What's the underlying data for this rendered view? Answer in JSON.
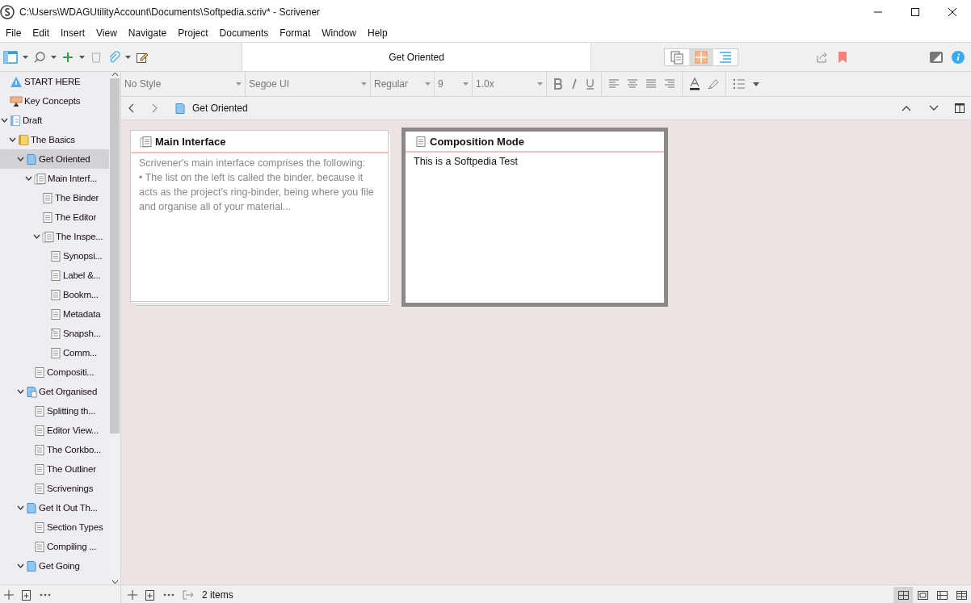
{
  "window": {
    "title": "C:\\Users\\WDAGUtilityAccount\\Documents\\Softpedia.scriv* - Scrivener"
  },
  "menu": [
    "File",
    "Edit",
    "Insert",
    "View",
    "Navigate",
    "Project",
    "Documents",
    "Format",
    "Window",
    "Help"
  ],
  "toolbar": {
    "document_title": "Get Oriented",
    "view_modes": [
      {
        "kind": "scrivenings",
        "selected": false
      },
      {
        "kind": "corkboard",
        "selected": true
      },
      {
        "kind": "outliner",
        "selected": false
      }
    ]
  },
  "format_bar": {
    "style": "No Style",
    "font": "Segoe UI",
    "weight": "Regular",
    "size": "9",
    "spacing": "1.0x"
  },
  "binder": [
    {
      "label": "START HERE",
      "kind": "info",
      "selected": false
    },
    {
      "label": "Key Concepts",
      "kind": "slides",
      "selected": false
    },
    {
      "label": "Draft",
      "kind": "draft",
      "selected": false,
      "expanded": true,
      "children": [
        {
          "label": "The Basics",
          "kind": "folder",
          "selected": false,
          "expanded": true,
          "children": [
            {
              "label": "Get Oriented",
              "kind": "chapter",
              "selected": true,
              "expanded": true,
              "children": [
                {
                  "label": "Main Interf...",
                  "kind": "stack",
                  "selected": false,
                  "expanded": true,
                  "children": [
                    {
                      "label": "The Binder",
                      "kind": "doc",
                      "selected": false
                    },
                    {
                      "label": "The Editor",
                      "kind": "doc",
                      "selected": false
                    },
                    {
                      "label": "The Inspe...",
                      "kind": "stack",
                      "selected": false,
                      "expanded": true,
                      "children": [
                        {
                          "label": "Synopsi...",
                          "kind": "doc",
                          "selected": false
                        },
                        {
                          "label": "Label &...",
                          "kind": "doc",
                          "selected": false
                        },
                        {
                          "label": "Bookm...",
                          "kind": "doc",
                          "selected": false
                        },
                        {
                          "label": "Metadata",
                          "kind": "doc",
                          "selected": false
                        },
                        {
                          "label": "Snapsh...",
                          "kind": "snapshot",
                          "selected": false
                        },
                        {
                          "label": "Comm...",
                          "kind": "doc",
                          "selected": false
                        }
                      ]
                    }
                  ]
                },
                {
                  "label": "Compositi...",
                  "kind": "doc",
                  "selected": false
                }
              ]
            },
            {
              "label": "Get Organised",
              "kind": "chapter-docs",
              "selected": false,
              "expanded": true,
              "children": [
                {
                  "label": "Splitting th...",
                  "kind": "doc",
                  "selected": false
                },
                {
                  "label": "Editor View...",
                  "kind": "doc",
                  "selected": false
                },
                {
                  "label": "The Corkbo...",
                  "kind": "doc",
                  "selected": false
                },
                {
                  "label": "The Outliner",
                  "kind": "doc",
                  "selected": false
                },
                {
                  "label": "Scrivenings",
                  "kind": "doc",
                  "selected": false
                }
              ]
            },
            {
              "label": "Get It Out Th...",
              "kind": "chapter",
              "selected": false,
              "expanded": true,
              "children": [
                {
                  "label": "Section Types",
                  "kind": "doc",
                  "selected": false
                },
                {
                  "label": "Compiling ...",
                  "kind": "doc",
                  "selected": false
                }
              ]
            },
            {
              "label": "Get Going",
              "kind": "chapter",
              "selected": false,
              "expanded": true
            }
          ]
        }
      ]
    }
  ],
  "editor_header": {
    "title": "Get Oriented"
  },
  "cards": [
    {
      "title": "Main Interface",
      "kind": "stack",
      "selected": false,
      "text": "Scrivener's main interface comprises the following:\n• The list on the left is called the binder, because it acts as the project's ring-binder, being where you file and organise all of your material..."
    },
    {
      "title": "Composition Mode",
      "kind": "doc",
      "selected": true,
      "text": "This is a Softpedia Test"
    }
  ],
  "status": {
    "count": "2 items",
    "view_buttons": [
      {
        "selected": true
      },
      {
        "selected": false
      },
      {
        "selected": false
      },
      {
        "selected": false
      }
    ]
  }
}
